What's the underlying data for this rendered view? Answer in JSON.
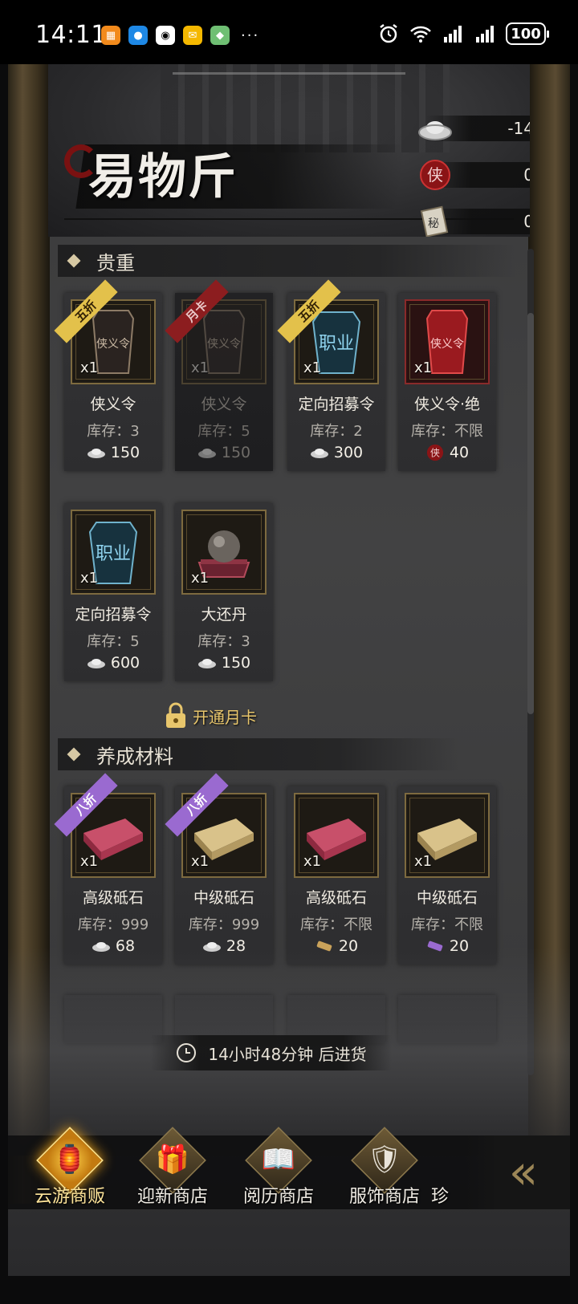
{
  "status_bar": {
    "time": "14:11",
    "battery": "100",
    "more": "···"
  },
  "header": {
    "title": "易物斤",
    "currencies": [
      {
        "icon": "silver-ingot-icon",
        "value": "-14"
      },
      {
        "icon": "xia-token-icon",
        "value": "0"
      },
      {
        "icon": "secret-book-icon",
        "value": "0"
      }
    ]
  },
  "sections": [
    {
      "title": "贵重",
      "items": [
        {
          "name": "侠义令",
          "stock_label": "库存：",
          "stock": "3",
          "price": "150",
          "currency": "silver",
          "tag": "五折",
          "tag_style": "gold",
          "qty": "x1",
          "thumb": "xiayi-token",
          "locked": false
        },
        {
          "name": "侠义令",
          "stock_label": "库存：",
          "stock": "5",
          "price": "150",
          "currency": "silver",
          "tag": "月卡",
          "tag_style": "red",
          "qty": "x1",
          "thumb": "xiayi-token",
          "locked": true
        },
        {
          "name": "定向招募令",
          "stock_label": "库存：",
          "stock": "2",
          "price": "300",
          "currency": "silver",
          "tag": "五折",
          "tag_style": "gold",
          "qty": "x1",
          "thumb": "career-token",
          "locked": false
        },
        {
          "name": "侠义令·绝",
          "stock_label": "库存：",
          "stock": "不限",
          "price": "40",
          "currency": "xia",
          "tag": "",
          "tag_style": "",
          "qty": "x1",
          "thumb": "xiayi-red",
          "locked": false
        },
        {
          "name": "定向招募令",
          "stock_label": "库存：",
          "stock": "5",
          "price": "600",
          "currency": "silver",
          "tag": "",
          "tag_style": "",
          "qty": "x1",
          "thumb": "career-token",
          "locked": false
        },
        {
          "name": "大还丹",
          "stock_label": "库存：",
          "stock": "3",
          "price": "150",
          "currency": "silver",
          "tag": "",
          "tag_style": "",
          "qty": "x1",
          "thumb": "pill",
          "locked": false
        }
      ],
      "lock_text": "开通月卡"
    },
    {
      "title": "养成材料",
      "items": [
        {
          "name": "高级砥石",
          "stock_label": "库存：",
          "stock": "999",
          "price": "68",
          "currency": "silver",
          "tag": "八折",
          "tag_style": "purple",
          "qty": "x1",
          "thumb": "whetstone-red"
        },
        {
          "name": "中级砥石",
          "stock_label": "库存：",
          "stock": "999",
          "price": "28",
          "currency": "silver",
          "tag": "八折",
          "tag_style": "purple",
          "qty": "x1",
          "thumb": "whetstone-gold"
        },
        {
          "name": "高级砥石",
          "stock_label": "库存：",
          "stock": "不限",
          "price": "20",
          "currency": "scroll-gold",
          "tag": "",
          "tag_style": "",
          "qty": "x1",
          "thumb": "whetstone-red"
        },
        {
          "name": "中级砥石",
          "stock_label": "库存：",
          "stock": "不限",
          "price": "20",
          "currency": "scroll-purple",
          "tag": "",
          "tag_style": "",
          "qty": "x1",
          "thumb": "whetstone-gold"
        }
      ]
    }
  ],
  "restock": "14小时48分钟 后进货",
  "nav": [
    {
      "label": "云游商贩",
      "icon": "pavilion-coin-icon",
      "active": true
    },
    {
      "label": "迎新商店",
      "icon": "treasure-chest-icon",
      "active": false
    },
    {
      "label": "阅历商店",
      "icon": "book-icon",
      "active": false
    },
    {
      "label": "服饰商店",
      "icon": "armor-icon",
      "active": false
    },
    {
      "label": "珍",
      "icon": "treasure-icon",
      "active": false
    }
  ],
  "nav_back": "«"
}
